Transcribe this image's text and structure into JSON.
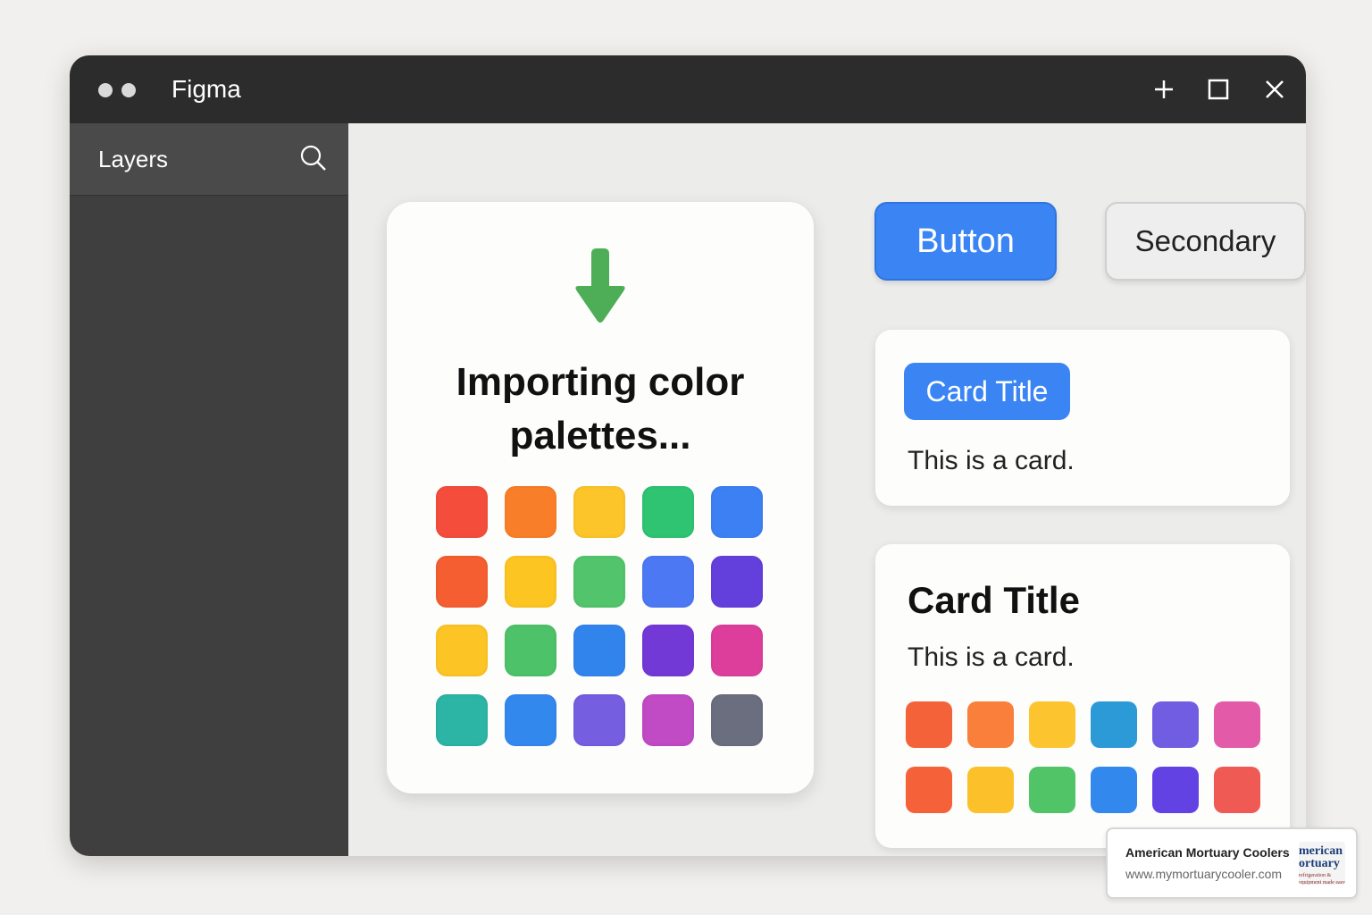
{
  "window": {
    "title": "Figma",
    "controls": {
      "new": "plus-icon",
      "maximize": "maximize-icon",
      "close": "close-icon"
    }
  },
  "sidebar": {
    "header": "Layers",
    "search_icon": "search-icon"
  },
  "import_card": {
    "icon": "down-arrow-icon",
    "icon_color": "#4eae57",
    "title": "Importing color palettes...",
    "swatch_rows": [
      [
        "#f44d3c",
        "#f97e2a",
        "#fcc52a",
        "#2ec471",
        "#3c80f4"
      ],
      [
        "#f55e30",
        "#fcc521",
        "#52c46b",
        "#4c78f3",
        "#6340dc"
      ],
      [
        "#fcc424",
        "#4dc268",
        "#3284ed",
        "#7339d6",
        "#dd3e9c"
      ],
      [
        "#2cb4a5",
        "#3388ee",
        "#755ee0",
        "#c14ac5",
        "#6a6e7f"
      ]
    ]
  },
  "buttons": {
    "primary_label": "Button",
    "primary_color": "#3a85f3",
    "secondary_label": "Secondary"
  },
  "card_a": {
    "title": "Card Title",
    "body": "This is a card."
  },
  "card_b": {
    "title": "Card Title",
    "body": "This is a card.",
    "swatch_rows": [
      [
        "#f4623a",
        "#f97f3a",
        "#fcc42e",
        "#2b9ad7",
        "#715de1",
        "#e25aa8"
      ],
      [
        "#f5623a",
        "#fcc12a",
        "#52c468",
        "#3388ee",
        "#6342e4",
        "#f05a55"
      ]
    ]
  },
  "watermark": {
    "name": "American Mortuary Coolers",
    "url": "www.mymortuarycooler.com",
    "logo_line1": "merican",
    "logo_line2": "ortuary",
    "logo_line3": "refrigeration & equipment made easy to comply"
  }
}
